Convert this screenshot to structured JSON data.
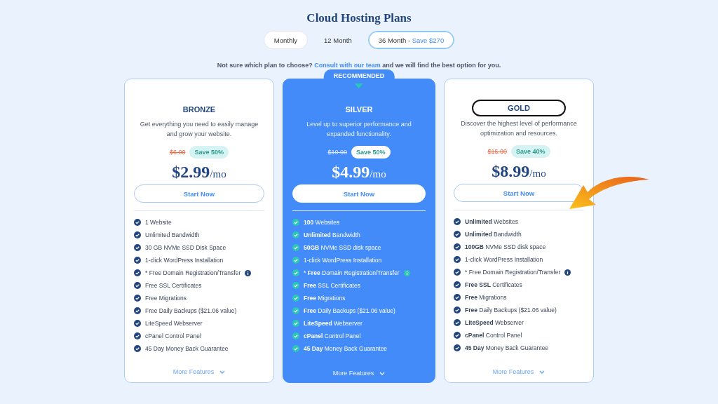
{
  "title": "Cloud Hosting Plans",
  "tabs": [
    {
      "label": "Monthly",
      "selected": false,
      "outlined": true
    },
    {
      "label": "12 Month",
      "selected": false,
      "outlined": false
    },
    {
      "label": "36 Month - ",
      "note": "Save $270",
      "selected": true,
      "outlined": true
    }
  ],
  "intro": {
    "before": "Not sure which plan to choose? ",
    "link": "Consult with our team",
    "after": " and we will find the best option for you."
  },
  "plans": [
    {
      "name": "BRONZE",
      "featured": false,
      "circled": false,
      "description": "Get everything you need to easily manage and grow your website.",
      "old_price": "$6.00",
      "save": "Save 50%",
      "price": "$2.99",
      "unit": "/mo",
      "button": "Start Now",
      "features": [
        {
          "text": "1 Website",
          "info": false
        },
        {
          "text": "Unlimited Bandwidth",
          "info": false
        },
        {
          "text": "30 GB NVMe SSD Disk Space",
          "info": false
        },
        {
          "text": "1-click WordPress Installation",
          "info": false
        },
        {
          "text": "* Free Domain Registration/Transfer",
          "info": true
        },
        {
          "text": "Free SSL Certificates",
          "info": false
        },
        {
          "text": "Free Migrations",
          "info": false
        },
        {
          "text": "Free Daily Backups ($21.06 value)",
          "info": false
        },
        {
          "text": "LiteSpeed Webserver",
          "info": false
        },
        {
          "text": "cPanel Control Panel",
          "info": false
        },
        {
          "text": "45 Day Money Back Guarantee",
          "info": false
        }
      ],
      "more": "More Features"
    },
    {
      "name": "SILVER",
      "featured": true,
      "badge": "RECOMMENDED",
      "circled": false,
      "description": "Level up to superior performance and expanded functionality.",
      "old_price": "$10.00",
      "save": "Save 50%",
      "price": "$4.99",
      "unit": "/mo",
      "button": "Start Now",
      "features": [
        {
          "text": "**100** Websites",
          "info": false
        },
        {
          "text": "**Unlimited** Bandwidth",
          "info": false
        },
        {
          "text": "**50GB** NVMe SSD disk space",
          "info": false
        },
        {
          "text": "1-click WordPress Installation",
          "info": false
        },
        {
          "text": "* **Free** Domain Registration/Transfer",
          "info": true
        },
        {
          "text": "**Free** SSL Certificates",
          "info": false
        },
        {
          "text": "**Free** Migrations",
          "info": false
        },
        {
          "text": "**Free** Daily Backups ($21.06 value)",
          "info": false
        },
        {
          "text": "**LiteSpeed** Webserver",
          "info": false
        },
        {
          "text": "**cPanel** Control Panel",
          "info": false
        },
        {
          "text": "**45 Day** Money Back Guarantee",
          "info": false
        }
      ],
      "more": "More Features"
    },
    {
      "name": "GOLD",
      "featured": false,
      "circled": true,
      "description": "Discover the highest level of performance optimization and resources.",
      "old_price": "$15.00",
      "save": "Save 40%",
      "price": "$8.99",
      "unit": "/mo",
      "button": "Start Now",
      "features": [
        {
          "text": "**Unlimited** Websites",
          "info": false
        },
        {
          "text": "**Unlimited** Bandwidth",
          "info": false
        },
        {
          "text": "**100GB** NVMe SSD disk space",
          "info": false
        },
        {
          "text": "1-click WordPress Installation",
          "info": false
        },
        {
          "text": "* Free Domain Registration/Transfer",
          "info": true
        },
        {
          "text": "**Free SSL** Certificates",
          "info": false
        },
        {
          "text": "**Free** Migrations",
          "info": false
        },
        {
          "text": "**Free** Daily Backups ($21.06 value)",
          "info": false
        },
        {
          "text": "**LiteSpeed** Webserver",
          "info": false
        },
        {
          "text": "**cPanel** Control Panel",
          "info": false
        },
        {
          "text": "**45 Day** Money Back Guarantee",
          "info": false
        }
      ],
      "more": "More Features"
    }
  ]
}
